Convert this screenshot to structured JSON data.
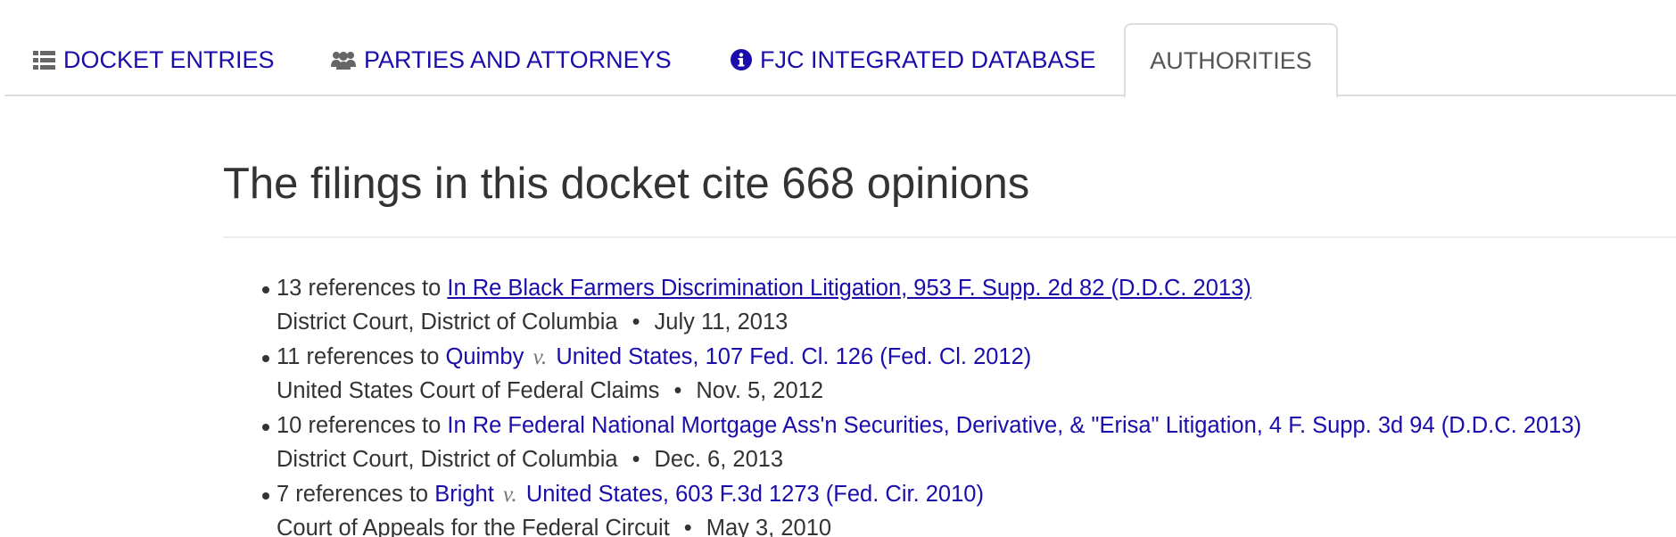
{
  "tabs": {
    "docket_entries": "DOCKET ENTRIES",
    "parties_attorneys": "PARTIES AND ATTORNEYS",
    "fjc_database": "FJC INTEGRATED DATABASE",
    "authorities": "AUTHORITIES"
  },
  "heading": "The filings in this docket cite 668 opinions",
  "separator": "•",
  "authorities": [
    {
      "references": "13 references to",
      "case_name": "In Re Black Farmers Discrimination Litigation, 953 F. Supp. 2d 82 (D.D.C. 2013)",
      "court": "District Court, District of Columbia",
      "date": "July 11, 2013"
    },
    {
      "references": "11 references to",
      "party_a": "Quimby",
      "versus": "v.",
      "party_b": "United States, 107 Fed. Cl. 126 (Fed. Cl. 2012)",
      "court": "United States Court of Federal Claims",
      "date": "Nov. 5, 2012"
    },
    {
      "references": "10 references to",
      "case_name": "In Re Federal National Mortgage Ass'n Securities, Derivative, & \"Erisa\" Litigation, 4 F. Supp. 3d 94 (D.D.C. 2013)",
      "court": "District Court, District of Columbia",
      "date": "Dec. 6, 2013"
    },
    {
      "references": "7 references to",
      "party_a": "Bright",
      "versus": "v.",
      "party_b": "United States, 603 F.3d 1273 (Fed. Cir. 2010)",
      "court": "Court of Appeals for the Federal Circuit",
      "date": "May 3, 2010"
    }
  ]
}
